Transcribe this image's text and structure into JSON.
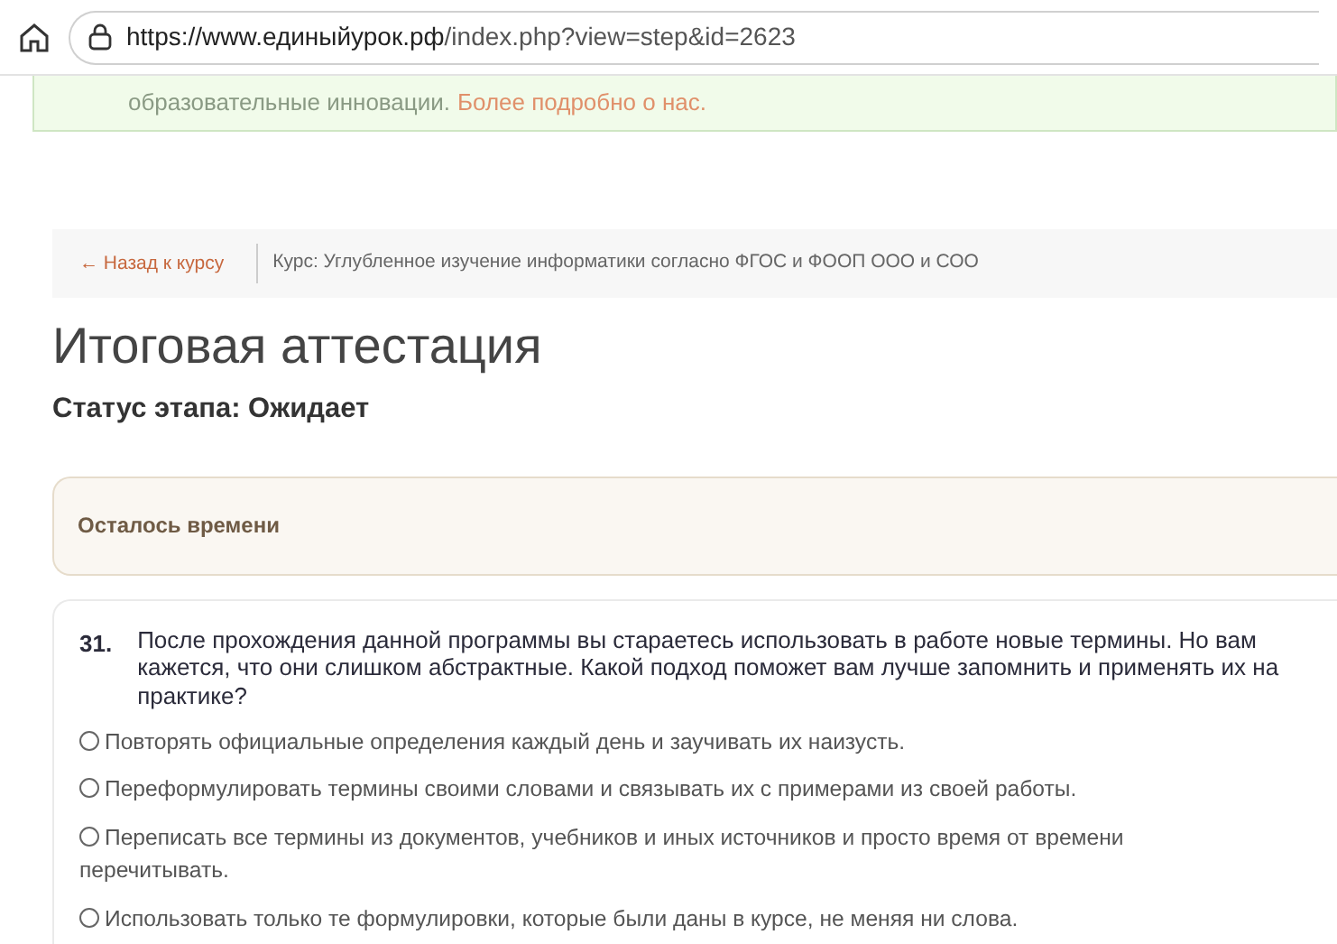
{
  "browser": {
    "url_host": "https://www.единыйурок.рф",
    "url_path": "/index.php?view=step&id=2623"
  },
  "notice": {
    "text": "образовательные инновации.",
    "link": "Более подробно о нас."
  },
  "breadcrumb": {
    "back": "← Назад к курсу",
    "course": "Курс: Углубленное изучение информатики согласно ФГОС и ФООП ООО и СОО"
  },
  "title": "Итоговая аттестация",
  "status": "Статус этапа: Ожидает",
  "timer": {
    "label": "Осталось времени"
  },
  "question": {
    "number": "31.",
    "text": "После прохождения данной программы вы стараетесь использовать в работе новые термины. Но вам кажется, что они слишком абстрактные. Какой подход поможет вам лучше запомнить и применять их на практике?",
    "options": [
      {
        "text": "Повторять официальные определения каждый день и заучивать их наизусть.",
        "selected": false
      },
      {
        "text": "Переформулировать термины своими словами и связывать их с примерами из своей работы.",
        "selected": false
      },
      {
        "text": "Переписать все термины из документов, учебников и иных источников и просто время от времени перечитывать.",
        "selected": false
      },
      {
        "text": "Использовать только те формулировки, которые были даны в курсе, не меняя ни слова.",
        "selected": false
      }
    ]
  }
}
